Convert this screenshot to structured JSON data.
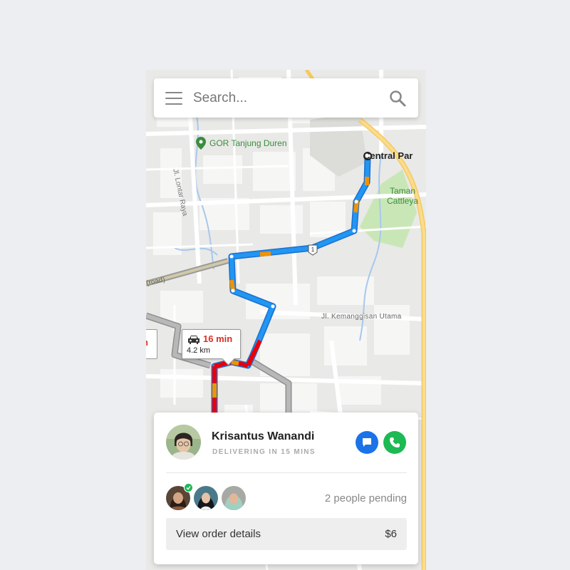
{
  "search": {
    "placeholder": "Search..."
  },
  "map": {
    "labels": {
      "gor": "GOR Tanjung Duren",
      "central": "Central Par",
      "taman": "Taman",
      "taman2": "Cattleya",
      "kemanggisan": "Jl. Kemanggisan Utama",
      "lontar": "Jl. Lontar Raya",
      "road": "l(road)",
      "route_number": "1"
    },
    "eta": {
      "time": "16 min",
      "distance": "4.2 km",
      "alt_time": "n"
    }
  },
  "driver": {
    "name": "Krisantus Wanandi",
    "status": "DELIVERING IN 15 MINS"
  },
  "pending": {
    "text": "2 people pending"
  },
  "order": {
    "label": "View order details",
    "price": "$6"
  },
  "colors": {
    "primary_blue": "#1a73e8",
    "call_green": "#1db954",
    "route_blue": "#2196f3",
    "traffic_orange": "#f29200",
    "traffic_red": "#e8000b",
    "eta_red": "#d93025"
  },
  "icons": {
    "menu": "hamburger-icon",
    "search": "magnifier-icon",
    "pin": "map-pin-icon",
    "car": "car-icon",
    "message": "chat-bubble-icon",
    "phone": "phone-icon",
    "check": "check-icon"
  }
}
